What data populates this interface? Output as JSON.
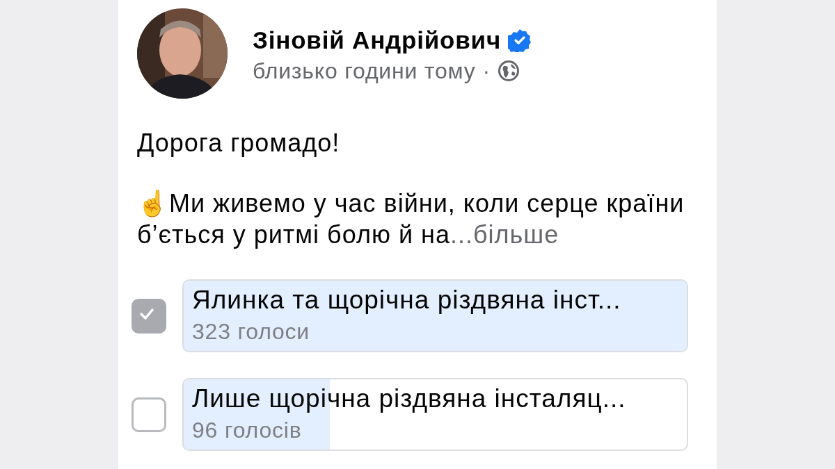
{
  "post": {
    "author": "Зіновій Андрійович",
    "verified": true,
    "time": "близько години тому",
    "separator": "·",
    "greeting": "Дорога громадо!",
    "text": "☝️Ми живемо у час війни, коли серце країни б’ється у ритмі болю й на",
    "more": "...більше"
  },
  "poll": {
    "options": [
      {
        "label": "Ялинка та щорічна різдвяна інст...",
        "votes": "323 голоси",
        "checked": true,
        "level": 1
      },
      {
        "label": "Лише щорічна різдвяна інсталяц...",
        "votes": "96 голосів",
        "checked": false,
        "level": 0.29
      }
    ]
  }
}
